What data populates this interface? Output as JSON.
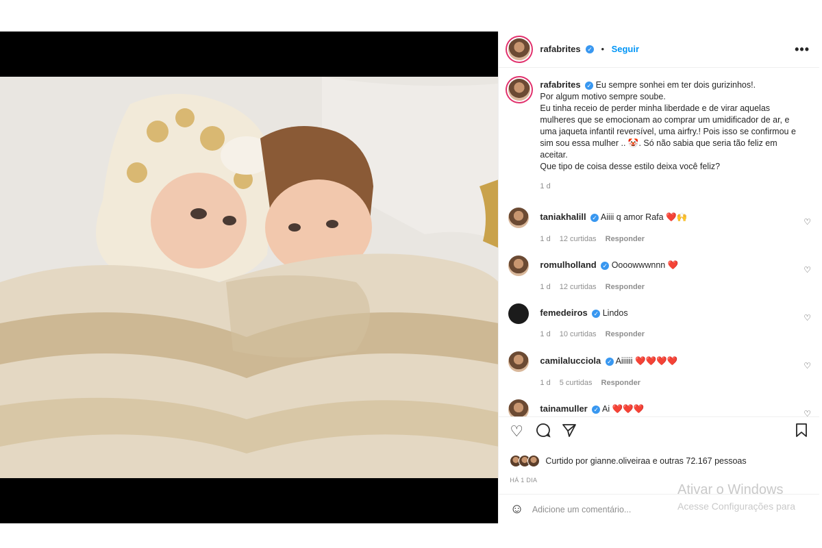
{
  "post": {
    "author": "rafabrites",
    "follow_label": "Seguir",
    "more_label": "•••",
    "caption_lines": [
      "Eu sempre sonhei em ter dois gurizinhos!.",
      "Por algum motivo sempre soube.",
      "Eu tinha receio de perder minha liberdade e de virar aquelas",
      "mulheres que se emocionam ao comprar um umidificador de ar, e",
      "uma jaqueta infantil reversível, uma airfry.! Pois isso se confirmou e",
      "sim sou essa mulher .. 🤡. Só não sabia que seria tão feliz em",
      "aceitar.",
      "Que tipo de coisa desse estilo deixa você feliz?"
    ],
    "caption_time": "1 d"
  },
  "comments": [
    {
      "user": "taniakhalill",
      "text": "Aiiii q amor Rafa",
      "emoji": "❤️🙌",
      "time": "1 d",
      "likes": "12 curtidas",
      "reply": "Responder"
    },
    {
      "user": "romulholland",
      "text": "Oooowwwnnn",
      "emoji": "❤️",
      "time": "1 d",
      "likes": "12 curtidas",
      "reply": "Responder"
    },
    {
      "user": "femedeiros",
      "text": "Lindos",
      "emoji": "",
      "time": "1 d",
      "likes": "10 curtidas",
      "reply": "Responder"
    },
    {
      "user": "camilalucciola",
      "text": "Aiiiiii",
      "emoji": "❤️❤️❤️❤️",
      "time": "1 d",
      "likes": "5 curtidas",
      "reply": "Responder"
    },
    {
      "user": "tainamuller",
      "text": "Ai",
      "emoji": "❤️❤️❤️",
      "time": "",
      "likes": "",
      "reply": ""
    }
  ],
  "likes_text": "Curtido por gianne.oliveiraa e outras 72.167 pessoas",
  "posted_ago": "HÁ 1 DIA",
  "comment_placeholder": "Adicione um comentário...",
  "watermark": {
    "line1": "Ativar o Windows",
    "line2": "Acesse Configurações para"
  },
  "colors": {
    "accent": "#0095f6",
    "verified": "#3897f0",
    "heart": "#ed1f2f"
  }
}
